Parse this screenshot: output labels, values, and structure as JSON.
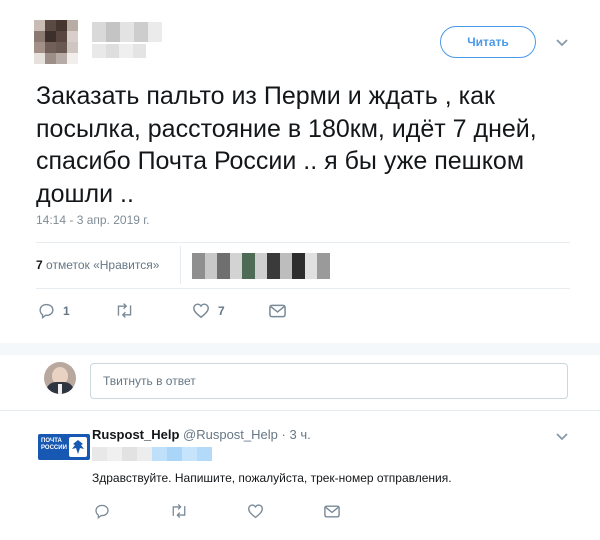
{
  "header": {
    "follow_label": "Читать"
  },
  "tweet": {
    "text": "Заказать пальто из Перми и ждать , как посылка, расстояние в 180км, идёт 7 дней, спасибо Почта России .. я бы уже пешком дошли ..",
    "timestamp": "14:14 - 3 апр. 2019 г.",
    "likes_count": "7",
    "likes_label": "отметок «Нравится»",
    "reply_count": "1",
    "like_action_count": "7"
  },
  "reply_input": {
    "placeholder": "Твитнуть в ответ"
  },
  "reply": {
    "name": "Ruspost_Help",
    "handle": "@Ruspost_Help",
    "separator": "·",
    "time": "3 ч.",
    "text": "Здравствуйте. Напишите, пожалуйста, трек-номер отправления.",
    "logo_text_1": "ПОЧТА",
    "logo_text_2": "РОССИИ"
  },
  "colors": {
    "accent": "#1da1f2",
    "follow_border": "#4a99e9",
    "muted": "#657786",
    "divider": "#e6ecf0"
  }
}
